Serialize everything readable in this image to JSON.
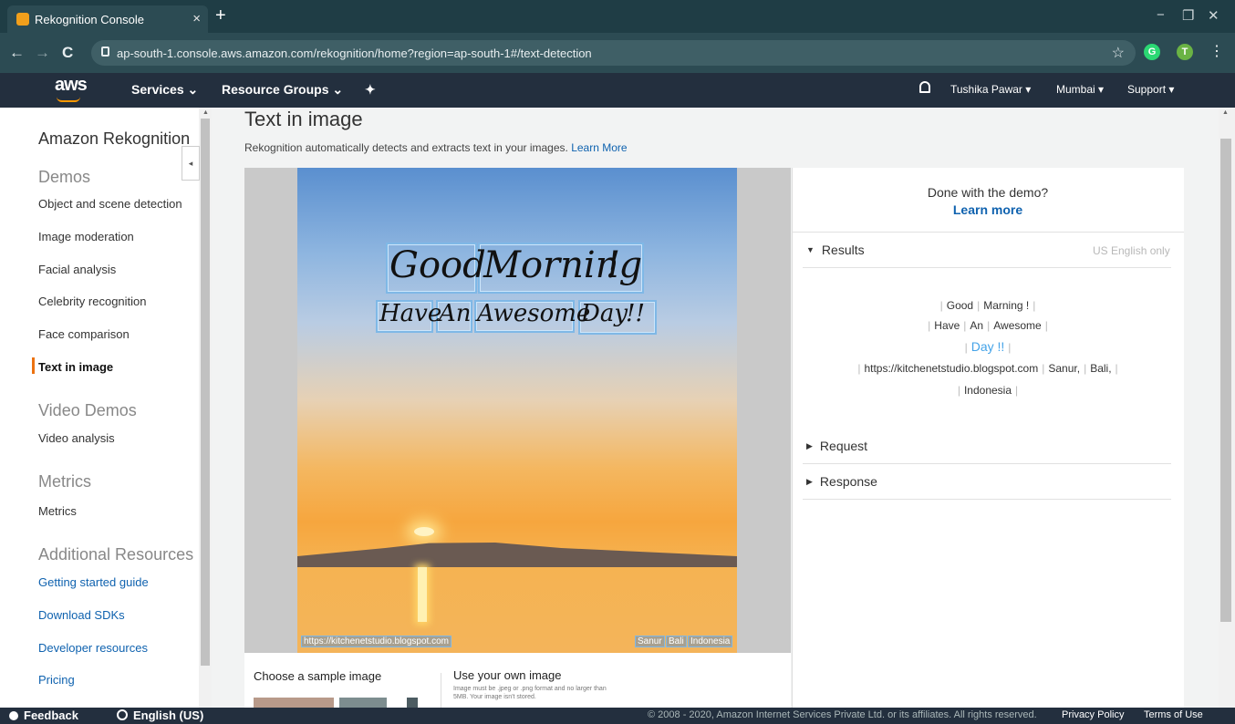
{
  "browser": {
    "tab_title": "Rekognition Console",
    "tab_close": "×",
    "new_tab": "+",
    "minimize": "−",
    "maximize": "❐",
    "close": "✕",
    "back": "←",
    "forward": "→",
    "reload": "C",
    "url": "ap-south-1.console.aws.amazon.com/rekognition/home?region=ap-south-1#/text-detection",
    "bookmark": "☆",
    "ext_g": "G",
    "profile": "T",
    "menu": "⋮"
  },
  "aws_nav": {
    "logo": "aws",
    "services": "Services ⌄",
    "resource_groups": "Resource Groups ⌄",
    "pin": "✦",
    "user": "Tushika Pawar ▾",
    "region": "Mumbai ▾",
    "support": "Support ▾"
  },
  "sidebar": {
    "title": "Amazon Rekognition",
    "collapse": "◂",
    "demos_head": "Demos",
    "demos": [
      "Object and scene detection",
      "Image moderation",
      "Facial analysis",
      "Celebrity recognition",
      "Face comparison"
    ],
    "active": "Text in image",
    "video_head": "Video Demos",
    "video_item": "Video analysis",
    "metrics_head": "Metrics",
    "metrics_item": "Metrics",
    "resources_head": "Additional Resources",
    "resources": [
      "Getting started guide",
      "Download SDKs",
      "Developer resources",
      "Pricing"
    ]
  },
  "main": {
    "title": "Text in image",
    "subtitle": "Rekognition automatically detects and extracts text in your images.",
    "subtitle_link": "Learn More",
    "image_text": {
      "line1": [
        "Good",
        "Morning",
        "!"
      ],
      "line2": [
        "Have",
        "An",
        "Awesome",
        "Day",
        "!!"
      ],
      "watermark_left": "https://kitchenetstudio.blogspot.com",
      "watermark_right": [
        "Sanur",
        "Bali",
        "Indonesia"
      ]
    },
    "sample_title": "Choose a sample image",
    "own_title": "Use your own image",
    "own_note": "Image must be .jpeg or .png format and no larger than 5MB. Your image isn't stored."
  },
  "results_panel": {
    "done_question": "Done with the demo?",
    "learn_more": "Learn more",
    "results_label": "Results",
    "results_note": "US English only",
    "rows": [
      [
        "Good",
        "Marning !"
      ],
      [
        "Have",
        "An",
        "Awesome"
      ],
      [
        "Day !!"
      ],
      [
        "https://kitchenetstudio.blogspot.com",
        "Sanur,",
        "Bali,"
      ],
      [
        "Indonesia"
      ]
    ],
    "request_label": "Request",
    "response_label": "Response"
  },
  "footer": {
    "feedback": "Feedback",
    "language": "English (US)",
    "copyright": "© 2008 - 2020, Amazon Internet Services Private Ltd. or its affiliates. All rights reserved.",
    "privacy": "Privacy Policy",
    "terms": "Terms of Use"
  },
  "colors": {
    "aws_nav_bg": "#232f3e",
    "link_blue": "#0f62af",
    "active_orange": "#ec7211",
    "highlight_blue": "#44a3e8"
  }
}
